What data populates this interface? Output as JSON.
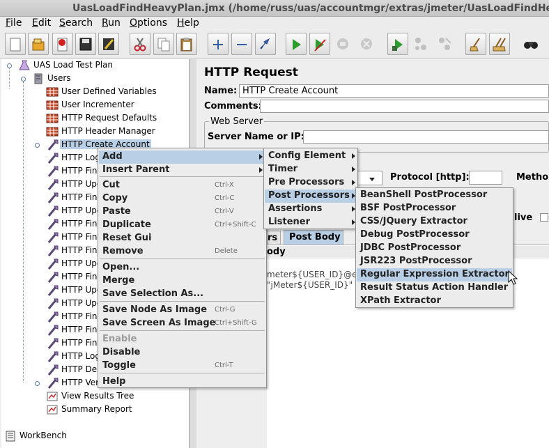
{
  "window": {
    "title": "UasLoadFindHeavyPlan.jmx (/home/russ/uas/accountmgr/extras/jmeter/UasLoadFindHeavyPlan.jmx)"
  },
  "menubar": {
    "file": {
      "mnemonic": "F",
      "rest": "ile"
    },
    "edit": {
      "mnemonic": "E",
      "rest": "dit"
    },
    "search": {
      "mnemonic": "S",
      "rest": "earch"
    },
    "run": {
      "mnemonic": "R",
      "rest": "un"
    },
    "options": {
      "mnemonic": "O",
      "rest": "ptions"
    },
    "help": {
      "mnemonic": "H",
      "rest": "elp"
    }
  },
  "tree": {
    "root": "UAS Load Test Plan",
    "thread_group": "Users",
    "items": [
      "User Defined Variables",
      "User Incrementer",
      "HTTP Request Defaults",
      "HTTP Header Manager",
      "HTTP Create Account",
      "HTTP Log",
      "HTTP Find",
      "HTTP Upd",
      "HTTP Find",
      "HTTP Upd",
      "HTTP Find",
      "HTTP Find",
      "HTTP Find",
      "HTTP Upd",
      "HTTP Find",
      "HTTP Upd",
      "HTTP Upd",
      "HTTP Find",
      "HTTP Find",
      "HTTP Find",
      "HTTP Log",
      "HTTP Del",
      "HTTP Verify Account Deleted",
      "View Results Tree",
      "Summary Report"
    ],
    "workbench": "WorkBench"
  },
  "request_panel": {
    "title": "HTTP Request",
    "name_label": "Name:",
    "name_value": "HTTP Create Account",
    "comments_label": "Comments:",
    "web_server_label": "Web Server",
    "server_label": "Server Name or IP:",
    "protocol_label": "Protocol [http]:",
    "method_label": "Metho",
    "keepalive_label": "live",
    "tab_params": "rs",
    "tab_body": "Post Body",
    "body_header": "ody",
    "body_line1": "meter${USER_ID}@e",
    "body_line2": "\"jMeter${USER_ID}\""
  },
  "context_menu": {
    "items": [
      {
        "label": "Add",
        "shortcut": ""
      },
      {
        "label": "Insert Parent",
        "shortcut": ""
      },
      {
        "label": "Cut",
        "shortcut": "Ctrl-X"
      },
      {
        "label": "Copy",
        "shortcut": "Ctrl-C"
      },
      {
        "label": "Paste",
        "shortcut": "Ctrl-V"
      },
      {
        "label": "Duplicate",
        "shortcut": "Ctrl+Shift-C"
      },
      {
        "label": "Reset Gui",
        "shortcut": ""
      },
      {
        "label": "Remove",
        "shortcut": "Delete"
      },
      {
        "label": "Open...",
        "shortcut": ""
      },
      {
        "label": "Merge",
        "shortcut": ""
      },
      {
        "label": "Save Selection As...",
        "shortcut": ""
      },
      {
        "label": "Save Node As Image",
        "shortcut": "Ctrl-G"
      },
      {
        "label": "Save Screen As Image",
        "shortcut": "Ctrl+Shift-G"
      },
      {
        "label": "Enable",
        "shortcut": ""
      },
      {
        "label": "Disable",
        "shortcut": ""
      },
      {
        "label": "Toggle",
        "shortcut": "Ctrl-T"
      },
      {
        "label": "Help",
        "shortcut": ""
      }
    ]
  },
  "add_submenu": {
    "items": [
      "Config Element",
      "Timer",
      "Pre Processors",
      "Post Processors",
      "Assertions",
      "Listener"
    ]
  },
  "post_processors_submenu": {
    "items": [
      "BeanShell PostProcessor",
      "BSF PostProcessor",
      "CSS/JQuery Extractor",
      "Debug PostProcessor",
      "JDBC PostProcessor",
      "JSR223 PostProcessor",
      "Regular Expression Extractor",
      "Result Status Action Handler",
      "XPath Extractor"
    ]
  },
  "colors": {
    "highlight": "#b8cfe5",
    "background": "#eeeeee",
    "play_green": "#2e9b2e",
    "scissors_red": "#c0202c"
  },
  "icons": {
    "toolbar": [
      "new-icon",
      "open-icon",
      "close-icon",
      "save-icon",
      "edit-icon",
      "cut-icon",
      "copy-icon",
      "paste-icon",
      "expand-icon",
      "collapse-icon",
      "toggle-icon",
      "start-icon",
      "start-no-pause-icon",
      "stop-icon",
      "shutdown-icon",
      "remote-start-icon",
      "remote-stop-icon",
      "remote-shutdown-icon",
      "clear-icon",
      "clear-all-icon",
      "search-icon"
    ]
  }
}
